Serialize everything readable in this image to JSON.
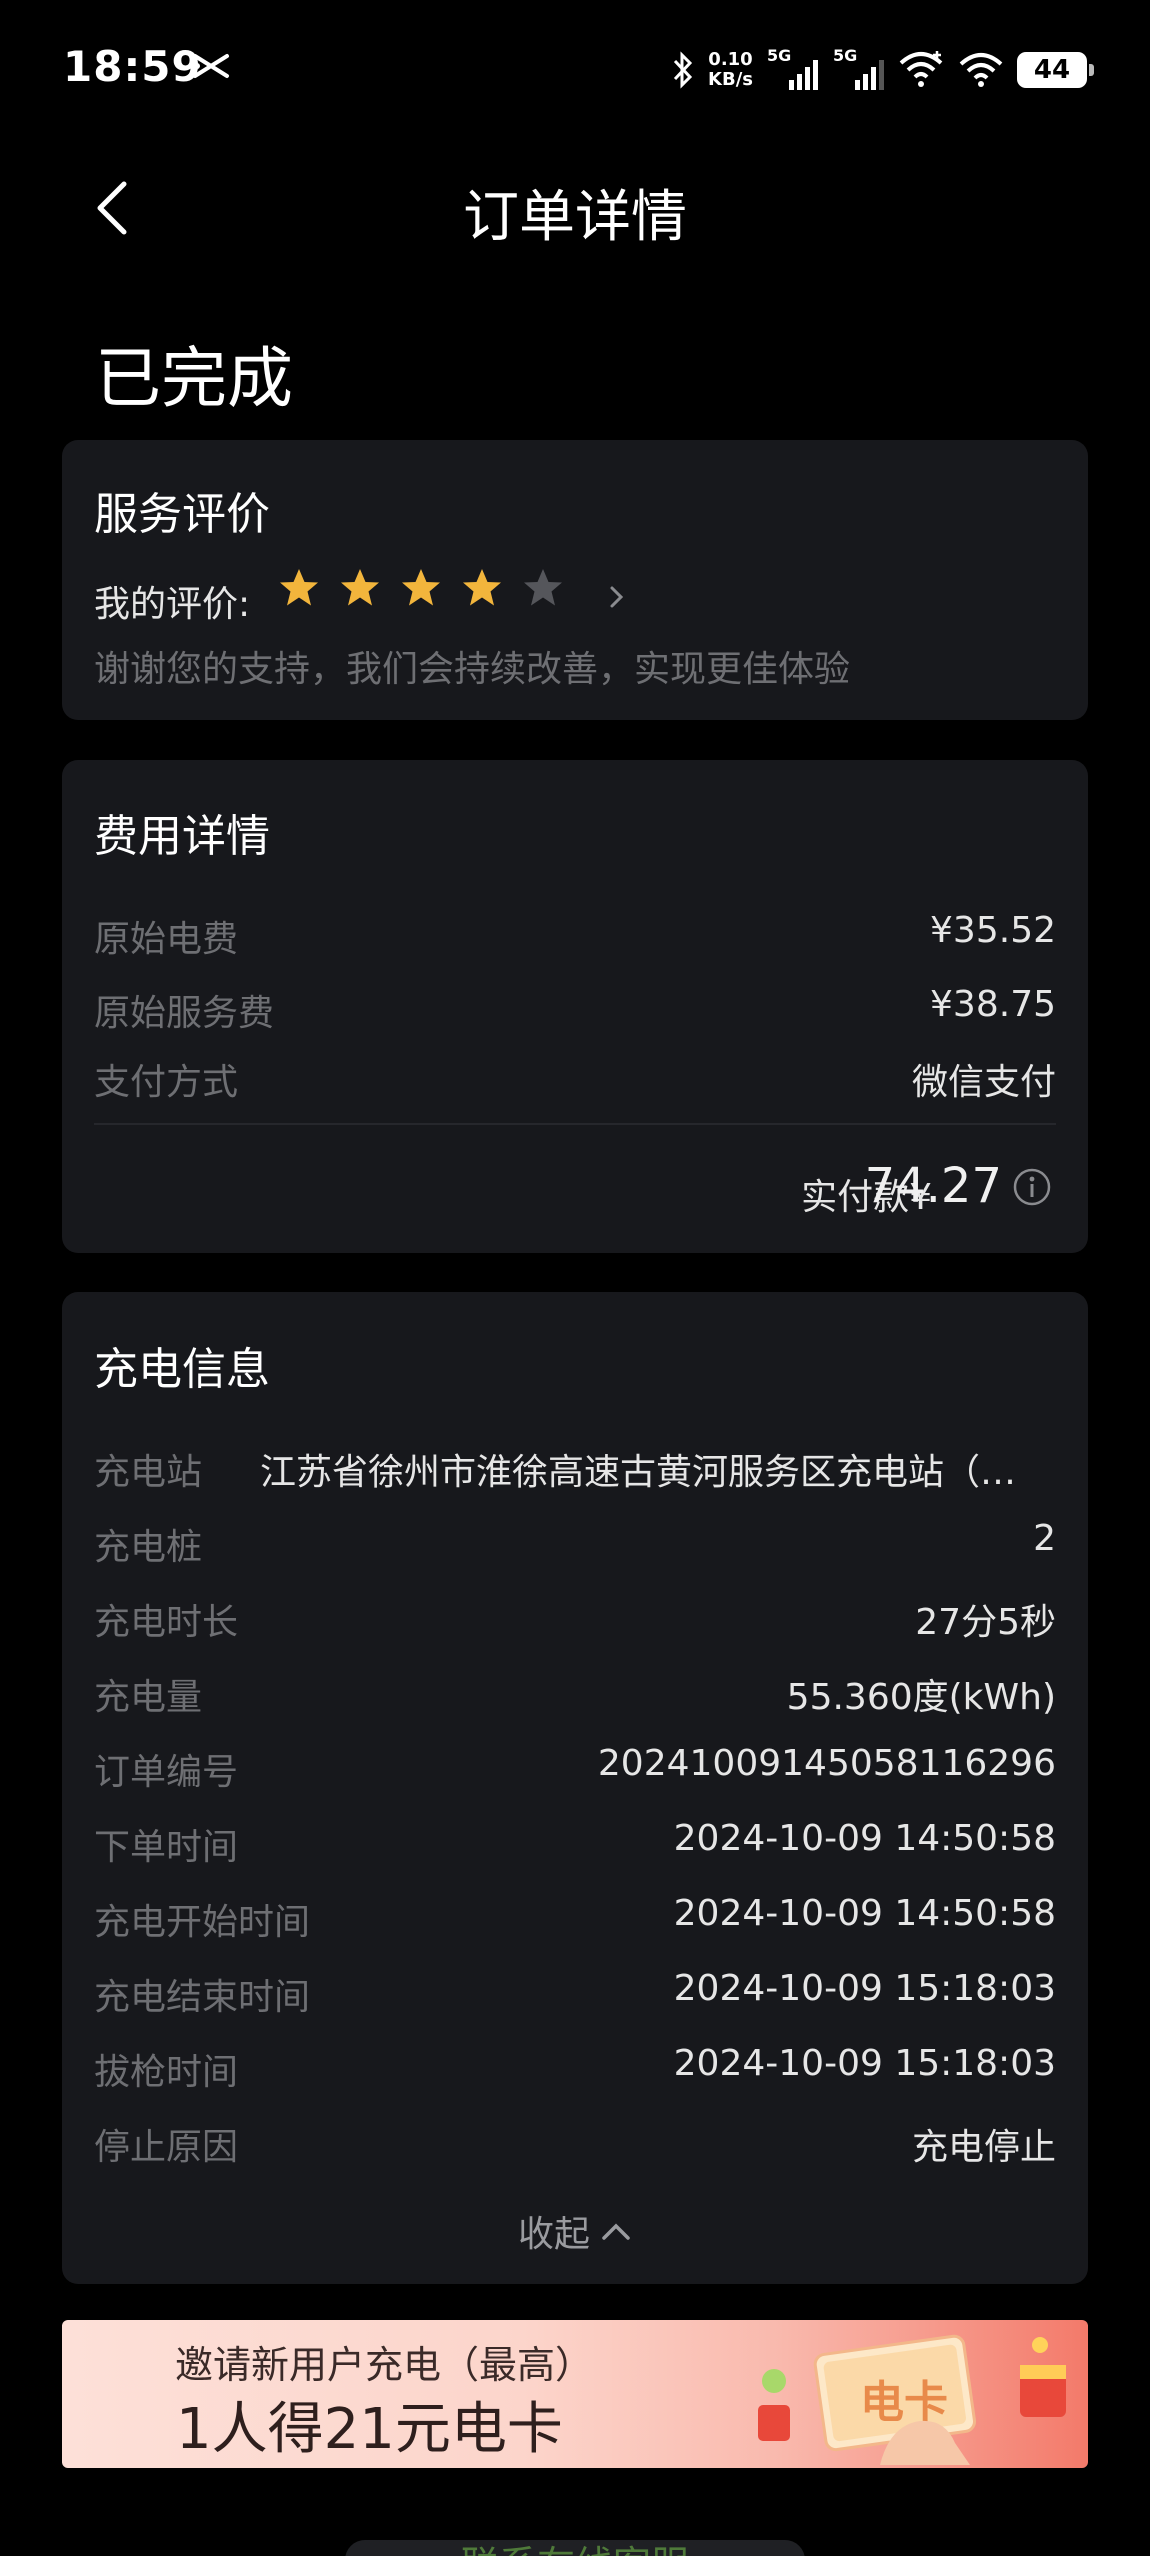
{
  "status_bar": {
    "time": "18:59",
    "net_speed_value": "0.10",
    "net_speed_unit": "KB/s",
    "sim1": "5G",
    "sim2": "5G",
    "battery": "44"
  },
  "nav": {
    "title": "订单详情"
  },
  "order_status": "已完成",
  "rating": {
    "title": "服务评价",
    "label": "我的评价:",
    "stars_filled": 4,
    "stars_total": 5,
    "note": "谢谢您的支持，我们会持续改善，实现更佳体验"
  },
  "fees": {
    "title": "费用详情",
    "rows": [
      {
        "label": "原始电费",
        "value": "¥35.52"
      },
      {
        "label": "原始服务费",
        "value": "¥38.75"
      },
      {
        "label": "支付方式",
        "value": "微信支付"
      }
    ],
    "paid_label": "实付款¥",
    "paid_amount": "74.27"
  },
  "charging": {
    "title": "充电信息",
    "station_label": "充电站",
    "station_value": "江苏省徐州市淮徐高速古黄河服务区充电站（…",
    "rows": [
      {
        "label": "充电桩",
        "value": "2"
      },
      {
        "label": "充电时长",
        "value": "27分5秒"
      },
      {
        "label": "充电量",
        "value": "55.360度(kWh)"
      },
      {
        "label": "订单编号",
        "value": "20241009145058116296"
      },
      {
        "label": "下单时间",
        "value": "2024-10-09 14:50:58"
      },
      {
        "label": "充电开始时间",
        "value": "2024-10-09 14:50:58"
      },
      {
        "label": "充电结束时间",
        "value": "2024-10-09 15:18:03"
      },
      {
        "label": "拔枪时间",
        "value": "2024-10-09 15:18:03"
      },
      {
        "label": "停止原因",
        "value": "充电停止"
      }
    ],
    "collapse_label": "收起"
  },
  "banner": {
    "line1": "邀请新用户充电（最高）",
    "line2": "1人得21元电卡",
    "card_text": "电卡"
  },
  "bottom_button": "联系在线客服",
  "colors": {
    "star_on": "#f2b53c",
    "star_off": "#55565b",
    "card_bg": "#17181c"
  }
}
